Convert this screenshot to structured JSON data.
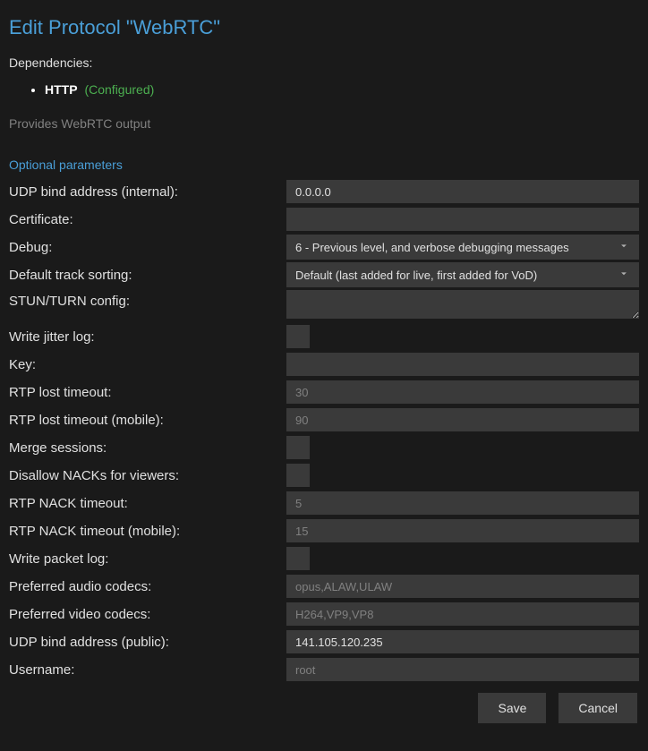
{
  "title": "Edit Protocol \"WebRTC\"",
  "dependencies": {
    "label": "Dependencies:",
    "items": [
      {
        "name": "HTTP",
        "status": "(Configured)"
      }
    ]
  },
  "description": "Provides WebRTC output",
  "section_header": "Optional parameters",
  "fields": {
    "udp_bind_internal": {
      "label": "UDP bind address (internal):",
      "value": "0.0.0.0"
    },
    "certificate": {
      "label": "Certificate:",
      "value": ""
    },
    "debug": {
      "label": "Debug:",
      "value": "6 - Previous level, and verbose debugging messages"
    },
    "default_track_sorting": {
      "label": "Default track sorting:",
      "value": "Default (last added for live, first added for VoD)"
    },
    "stun_turn": {
      "label": "STUN/TURN config:",
      "value": ""
    },
    "write_jitter_log": {
      "label": "Write jitter log:"
    },
    "key": {
      "label": "Key:",
      "value": ""
    },
    "rtp_lost_timeout": {
      "label": "RTP lost timeout:",
      "placeholder": "30",
      "value": ""
    },
    "rtp_lost_timeout_mobile": {
      "label": "RTP lost timeout (mobile):",
      "placeholder": "90",
      "value": ""
    },
    "merge_sessions": {
      "label": "Merge sessions:"
    },
    "disallow_nacks": {
      "label": "Disallow NACKs for viewers:"
    },
    "rtp_nack_timeout": {
      "label": "RTP NACK timeout:",
      "placeholder": "5",
      "value": ""
    },
    "rtp_nack_timeout_mobile": {
      "label": "RTP NACK timeout (mobile):",
      "placeholder": "15",
      "value": ""
    },
    "write_packet_log": {
      "label": "Write packet log:"
    },
    "preferred_audio_codecs": {
      "label": "Preferred audio codecs:",
      "placeholder": "opus,ALAW,ULAW",
      "value": ""
    },
    "preferred_video_codecs": {
      "label": "Preferred video codecs:",
      "placeholder": "H264,VP9,VP8",
      "value": ""
    },
    "udp_bind_public": {
      "label": "UDP bind address (public):",
      "value": "141.105.120.235"
    },
    "username": {
      "label": "Username:",
      "placeholder": "root",
      "value": ""
    }
  },
  "buttons": {
    "save": "Save",
    "cancel": "Cancel"
  }
}
